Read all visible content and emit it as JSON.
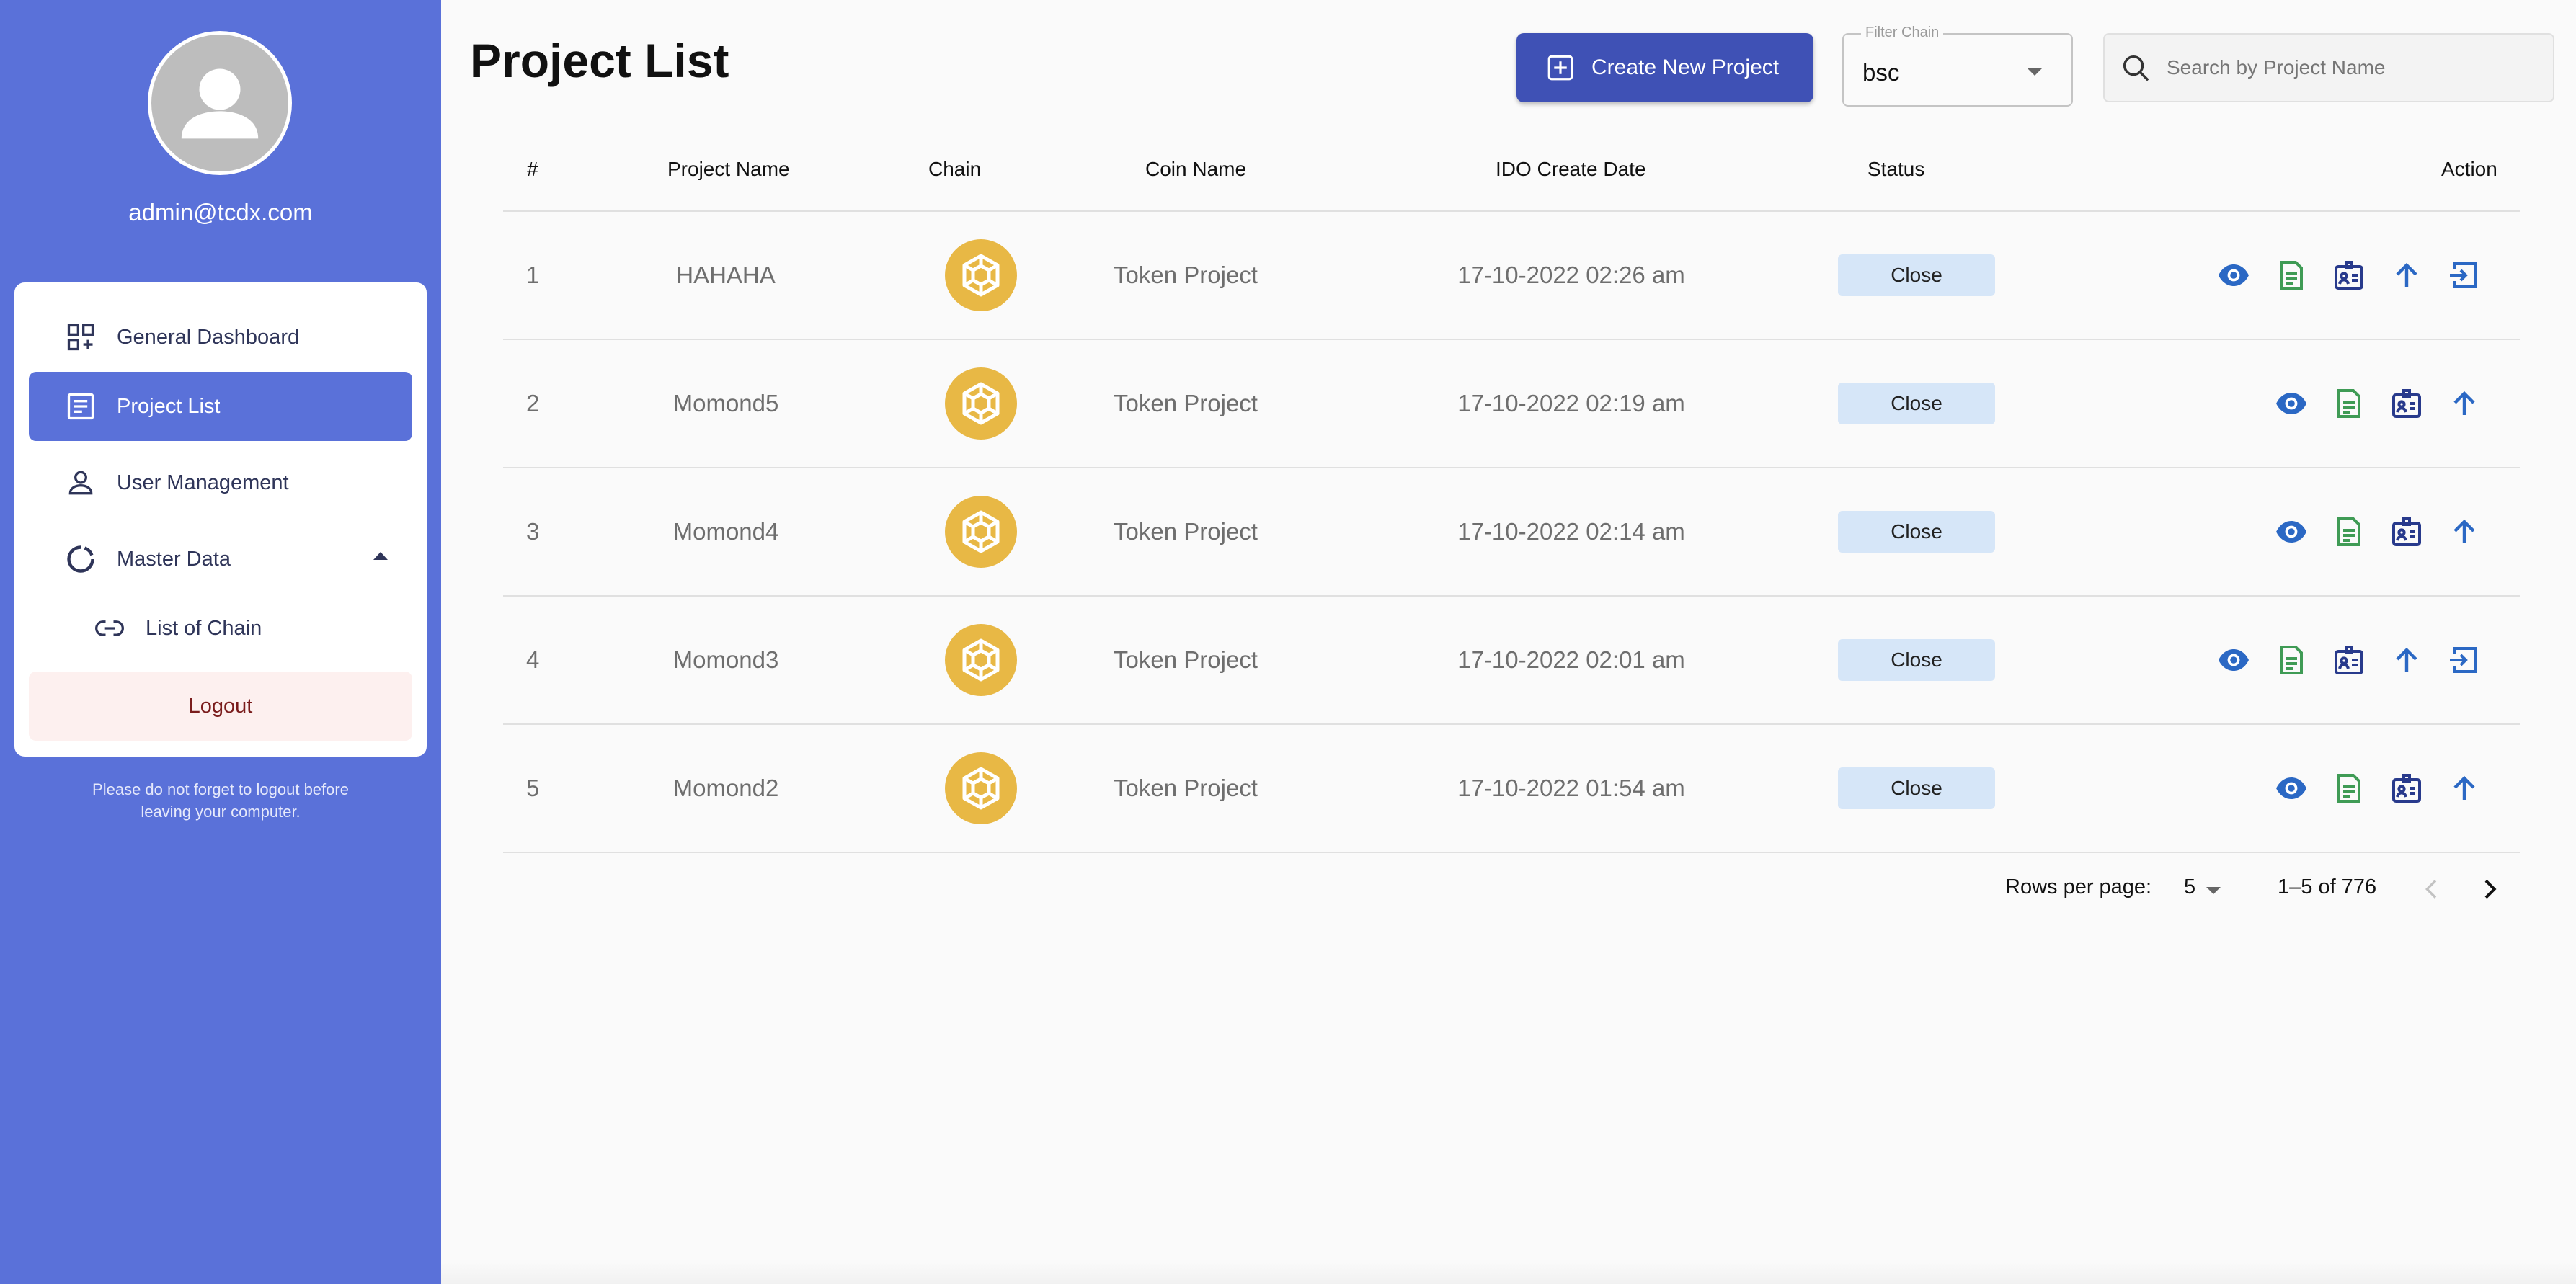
{
  "sidebar": {
    "admin_email": "admin@tcdx.com",
    "items": [
      {
        "label": "General Dashboard",
        "icon": "dashboard-icon"
      },
      {
        "label": "Project List",
        "icon": "list-icon",
        "active": true
      },
      {
        "label": "User Management",
        "icon": "person-icon"
      },
      {
        "label": "Master Data",
        "icon": "donut-icon",
        "expanded": true
      },
      {
        "label": "List of Chain",
        "icon": "link-icon"
      }
    ],
    "logout_label": "Logout",
    "logout_note": "Please do not forget to logout before leaving your computer."
  },
  "header": {
    "title": "Project List",
    "create_label": "Create New Project",
    "filter_label": "Filter Chain",
    "filter_value": "bsc",
    "search_placeholder": "Search by Project Name"
  },
  "table": {
    "columns": [
      "#",
      "Project Name",
      "Chain",
      "Coin Name",
      "IDO Create Date",
      "Status",
      "Action"
    ],
    "rows": [
      {
        "num": "1",
        "name": "HAHAHA",
        "coin": "Token Project",
        "date": "17-10-2022 02:26 am",
        "status": "Close",
        "actions": [
          "view",
          "doc",
          "id",
          "up",
          "login"
        ]
      },
      {
        "num": "2",
        "name": "Momond5",
        "coin": "Token Project",
        "date": "17-10-2022 02:19 am",
        "status": "Close",
        "actions": [
          "view",
          "doc",
          "id",
          "up"
        ]
      },
      {
        "num": "3",
        "name": "Momond4",
        "coin": "Token Project",
        "date": "17-10-2022 02:14 am",
        "status": "Close",
        "actions": [
          "view",
          "doc",
          "id",
          "up"
        ]
      },
      {
        "num": "4",
        "name": "Momond3",
        "coin": "Token Project",
        "date": "17-10-2022 02:01 am",
        "status": "Close",
        "actions": [
          "view",
          "doc",
          "id",
          "up",
          "login"
        ]
      },
      {
        "num": "5",
        "name": "Momond2",
        "coin": "Token Project",
        "date": "17-10-2022 01:54 am",
        "status": "Close",
        "actions": [
          "view",
          "doc",
          "id",
          "up"
        ]
      }
    ]
  },
  "pagination": {
    "rows_label": "Rows per page:",
    "rows_value": "5",
    "range": "1–5 of 776"
  },
  "colors": {
    "sidebar": "#5a71d9",
    "primary_button": "#3f51b5",
    "chain_logo": "#e8b845",
    "status_badge": "#d6e6f8",
    "action_blue": "#2b68c4",
    "action_green": "#3f9b55",
    "action_navy": "#283a8c"
  }
}
